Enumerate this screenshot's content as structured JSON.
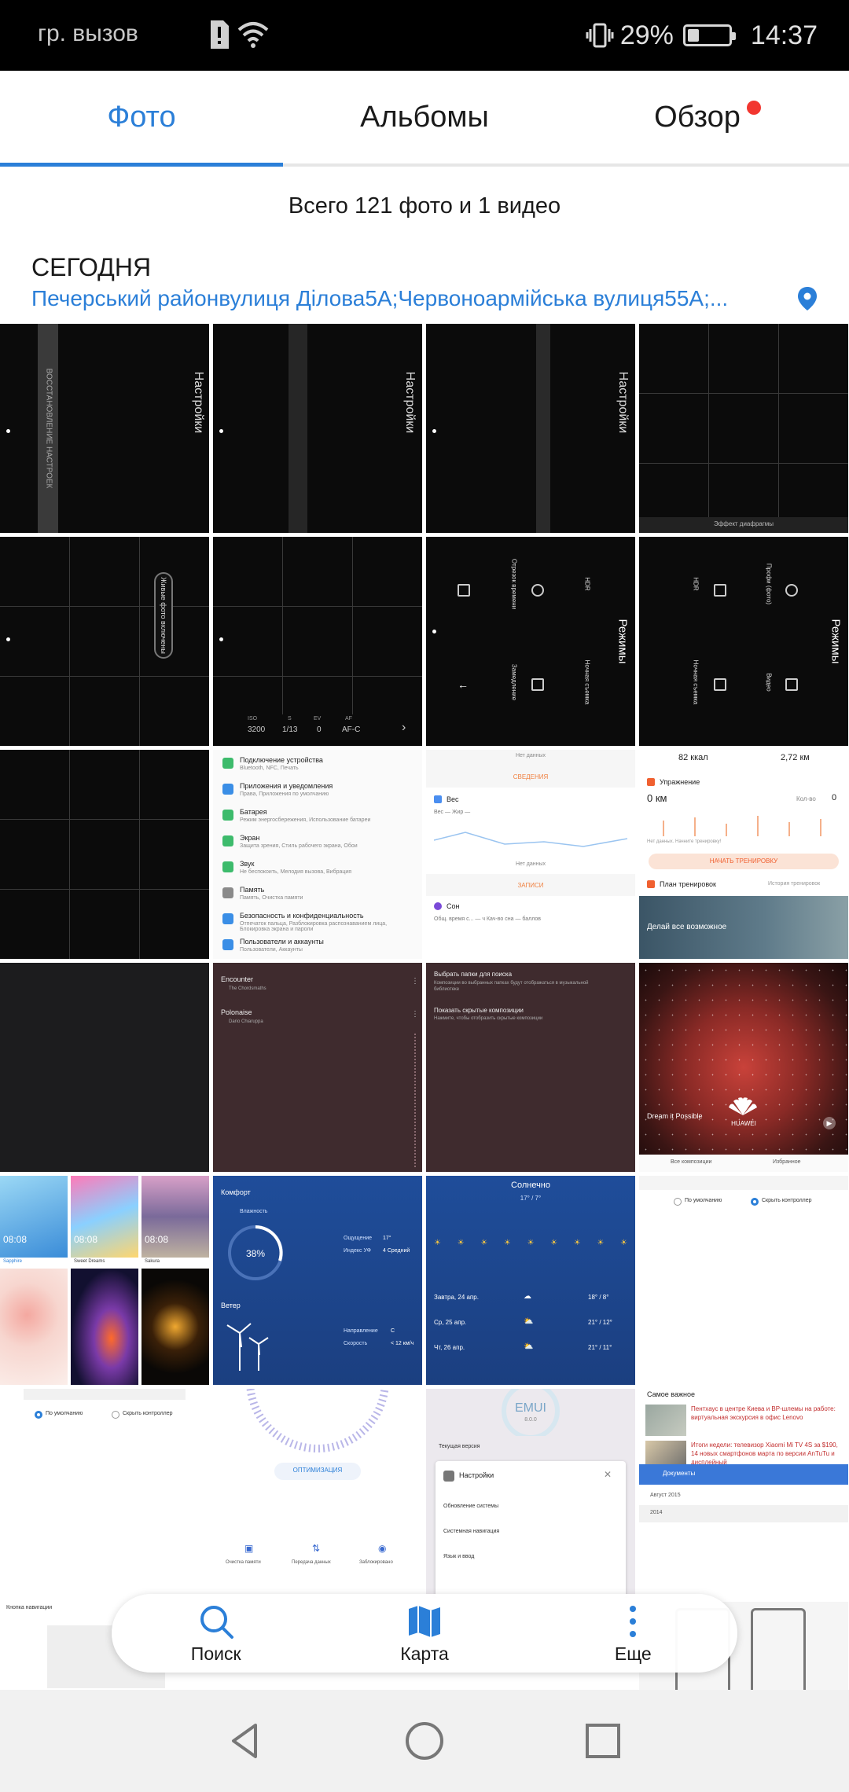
{
  "status_bar": {
    "carrier": "гр. вызов",
    "battery_percent": "29%",
    "battery_level": 0.29,
    "time": "14:37"
  },
  "tabs": [
    {
      "label": "Фото",
      "active": true
    },
    {
      "label": "Альбомы",
      "active": false
    },
    {
      "label": "Обзор",
      "active": false,
      "badge": true
    }
  ],
  "summary": "Всего 121 фото и 1 видео",
  "section": {
    "date_label": "СЕГОДНЯ",
    "location": "Печерський районвулиця Ділова5А;Червоноармійська вулиця55А;..."
  },
  "thumbnails": {
    "cam1": {
      "vertical_title": "Настройки",
      "vertical_label": "ВОССТАНОВЛЕНИЕ НАСТРОЕК"
    },
    "cam2": {
      "vertical_title": "Настройки"
    },
    "cam3": {
      "vertical_title": "Настройки"
    },
    "cam4": {
      "label": "Эффект диафрагмы"
    },
    "cam5": {
      "vertical_label": "Живые фото включены"
    },
    "cam6": {
      "iso_label": "ISO",
      "iso_value": "3200",
      "s_label": "S",
      "s_value": "1/13",
      "ev_label": "EV",
      "ev_value": "0",
      "af_label": "AF",
      "af_value": "AF-C"
    },
    "modes1": {
      "vertical_title": "Режимы",
      "items": [
        "Отрезок времени",
        "HDR",
        "Замедление",
        "Ночная съемка"
      ]
    },
    "modes2": {
      "vertical_title": "Режимы",
      "items": [
        "HDR",
        "Профи (фото)",
        "Ночная съемка",
        "Видео"
      ]
    },
    "settings_list": [
      {
        "title": "Подключение устройства",
        "subtitle": "Bluetooth, NFC, Печать",
        "color": "#3dbb6c"
      },
      {
        "title": "Приложения и уведомления",
        "subtitle": "Права, Приложения по умолчанию",
        "color": "#3a8ee6"
      },
      {
        "title": "Батарея",
        "subtitle": "Режим энергосбережения, Использование батареи",
        "color": "#3dbb6c"
      },
      {
        "title": "Экран",
        "subtitle": "Защита зрения, Стиль рабочего экрана, Обои",
        "color": "#3dbb6c"
      },
      {
        "title": "Звук",
        "subtitle": "Не беспокоить, Мелодия вызова, Вибрация",
        "color": "#3dbb6c"
      },
      {
        "title": "Память",
        "subtitle": "Память, Очистка памяти",
        "color": "#8a8a8a"
      },
      {
        "title": "Безопасность и конфиденциальность",
        "subtitle": "Отпечаток пальца, Разблокировка распознаванием лица, Блокировка экрана и пароли",
        "color": "#3a8ee6"
      },
      {
        "title": "Пользователи и аккаунты",
        "subtitle": "Пользователи, Аккаунты",
        "color": "#3a8ee6"
      }
    ],
    "health1": {
      "no_data": "Нет данных",
      "section1": "СВЕДЕНИЯ",
      "weight": "Вес",
      "weight_sub": "Вес — Жир —",
      "no_data2": "Нет данных",
      "records": "ЗАПИСИ",
      "sleep": "Сон",
      "sleep_sub": "Общ. время с... — ч  Кач-во сна — баллов"
    },
    "health2": {
      "kcal": "82 ккал",
      "km": "2,72 км",
      "exercise": "Упражнение",
      "zero_km": "0 км",
      "count_label": "Кол-во",
      "count_value": "0",
      "no_data": "Нет данных. Начните тренировку!",
      "start": "НАЧАТЬ ТРЕНИРОВКУ",
      "plan": "План тренировок",
      "history": "История тренировок",
      "promo": "Делай все возможное"
    },
    "music1": {
      "track1": "Encounter",
      "artist1": "The Chordsmaths",
      "track2": "Polonaise",
      "artist2": "Dario Chiaruppa"
    },
    "music2": {
      "option1": "Выбрать папки для поиска",
      "option1_sub": "Композиции во выбранных папках будут отображаться в музыкальной библиотеке",
      "option2": "Показать скрытые композиции",
      "option2_sub": "Нажмите, чтобы отобразить скрытые композиции"
    },
    "nebula": {
      "slogan": "Dream it Possible",
      "brand": "HUAWEI",
      "tab1": "Все композиции",
      "tab2": "Избранное"
    },
    "themes": {
      "time": "08:08",
      "names": [
        "Sapphire",
        "Sweet Dreams",
        "Sakura"
      ]
    },
    "weather1": {
      "title": "Комфорт",
      "humidity_label": "Влажность",
      "humidity_value": "38%",
      "feels_label": "Ощущение",
      "feels_value": "17°",
      "uv_label": "Индекс УФ",
      "uv_value": "4 Средний",
      "wind_title": "Ветер",
      "dir_label": "Направление",
      "dir_value": "С",
      "speed_label": "Скорость",
      "speed_value": "< 12 км/ч"
    },
    "weather2": {
      "title": "Солнечно",
      "range": "17° / 7°",
      "rows": [
        {
          "day": "Завтра, 24 апр.",
          "temp": "18° / 8°"
        },
        {
          "day": "Ср, 25 апр.",
          "temp": "21° / 12°"
        },
        {
          "day": "Чт, 26 апр.",
          "temp": "21° / 11°"
        }
      ]
    },
    "radio1": {
      "opt1": "По умолчанию",
      "opt2": "Скрыть контроллер"
    },
    "radio2": {
      "opt1": "По умолчанию",
      "opt2": "Скрыть контроллер"
    },
    "optimizer": {
      "button": "ОПТИМИЗАЦИЯ",
      "a1": "Очистка памяти",
      "a2": "Передача данных",
      "a3": "Заблокировано"
    },
    "emui": {
      "logo": "EMUI",
      "version": "8.0.0",
      "current": "Текущая версия",
      "dialog_title": "Настройки",
      "rows": [
        "Обновление системы",
        "Системная навигация",
        "Язык и ввод"
      ]
    },
    "news": {
      "header": "Самое важное",
      "item1": "Пентхаус в центре Киева и ВР-шлемы на работе: виртуальная экскурсия в офис Lenovo",
      "item2": "Итоги недели: телевизор Xiaomi Mi TV 4S за $190, 14 новых смартфонов марта по версии AnTuTu и дисплейный",
      "docs": "Документы",
      "month": "Август 2015",
      "year": "2014"
    },
    "nav_label": "Кнопка навигации"
  },
  "toolbar": [
    {
      "label": "Поиск",
      "icon": "search-icon"
    },
    {
      "label": "Карта",
      "icon": "map-icon"
    },
    {
      "label": "Еще",
      "icon": "more-vert-icon"
    }
  ],
  "colors": {
    "accent": "#2b7fd8",
    "badge": "#f2362f"
  }
}
